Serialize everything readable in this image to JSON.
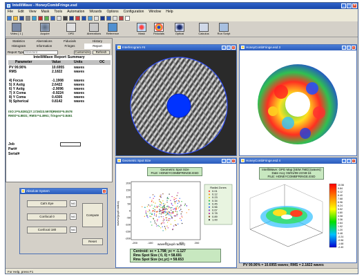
{
  "colors": {
    "title_blue": "#2a5bbb",
    "green_panel": "#c8e8c0",
    "pupil_blue": "#0033ff"
  },
  "window": {
    "title": "IntelliWave - HoneyCombFringe.esd"
  },
  "menu": [
    "File",
    "Edit",
    "View",
    "Mask",
    "Tools",
    "Automation",
    "Wizards",
    "Options",
    "Configuration",
    "Window",
    "Help"
  ],
  "toolbar": [
    "Video [ 1 ]",
    "Acquire",
    "OPD",
    "Aberrations",
    "Reference",
    "Mask",
    "Fiducials",
    "Optical",
    "Calculus",
    "Run Script"
  ],
  "report": {
    "tabs": [
      "Statistics",
      "Histogram",
      "Aberrations",
      "Information",
      "Fiducials",
      "Fringes",
      "History",
      "Report"
    ],
    "type_label": "Report Type",
    "type_value": "Standard",
    "customize": "Customize",
    "refresh": "Refresh",
    "title": "IntelliWave Report Summary",
    "headers": [
      "Parameter",
      "Value",
      "Units",
      "OC"
    ],
    "rows": [
      {
        "p": "PV 99.90%",
        "v": "10.6955",
        "u": "waves"
      },
      {
        "p": "RMS",
        "v": "2.1822",
        "u": "waves"
      },
      {
        "p": "4) Focus",
        "v": "-1.1908",
        "u": "waves"
      },
      {
        "p": "5) X Astig",
        "v": "2.6422",
        "u": "waves"
      },
      {
        "p": "6) Y Astig",
        "v": "-2.9096",
        "u": "waves"
      },
      {
        "p": "7) X Coma",
        "v": "-0.9224",
        "u": "waves"
      },
      {
        "p": "8) Y Coma",
        "v": "0.4305",
        "u": "waves"
      },
      {
        "p": "9) Spherical",
        "v": "0.8142",
        "u": "waves"
      }
    ],
    "summary1": "ISO:3=5.8281(27.1726/23.5978)RMSt=5.0578",
    "summary2": "RMSi=4.8831; RMSr=4.4951; fringes=2.8461",
    "inputs": [
      "Job",
      "Part#",
      "Serial#"
    ]
  },
  "absolute": {
    "title": "Absolute System",
    "buttons": [
      "Cat's Eye",
      "Confocal 0",
      "Confocal 180"
    ],
    "status": "NG",
    "compute": "Compute",
    "reset": "Reset"
  },
  "interferogram": {
    "title": "Interferogram #4"
  },
  "opdmap": {
    "title": "HoneyCombFringe.esd 3"
  },
  "spot": {
    "title": "Geometric Spot Size",
    "header1": "Geometric Spot Size",
    "header2": "FILE: HONEYCOMBFRINGE.ESD",
    "ylabel": "waves/(pupil radius)",
    "xlabel": "waves/(pupil radius)",
    "yticks": [
      "200",
      "150",
      "100",
      "50",
      "0",
      "-50",
      "-100",
      "-150",
      "-200"
    ],
    "xticks": [
      "-200",
      "-100",
      "0",
      "100",
      "200"
    ],
    "legend_title": "Radial Zones",
    "zones": [
      "0.01",
      "0.12",
      "0.23",
      "0.34",
      "0.45",
      "0.56",
      "0.67",
      "0.78",
      "0.89",
      "1.00"
    ],
    "centroid": "Centroid: xc = 1.798; yc = -1.127",
    "rms": "Rms Spot Size ( 0, 0) = 58.691",
    "rms2": "Rms Spot Size (xc,yc) = 58.653"
  },
  "map3d": {
    "title": "HoneyCombFringe.esd 4",
    "header1": "IntelliWave: OPD Map [SEM.TMD] (waves)",
    "header2": "Date Acq: 03/01/08 23:59:16",
    "header3": "FILE: HONEYCOMBFRINGE.ESD",
    "colorbar": [
      "10.56",
      "9.84",
      "9.12",
      "8.40",
      "7.68",
      "6.96",
      "6.24",
      "5.52",
      "4.80",
      "4.08",
      "3.36",
      "2.64",
      "1.92",
      "1.20",
      "0.48",
      "-0.24",
      "-0.96",
      "-1.68",
      "-2.40"
    ]
  },
  "pv_readout": "PV 99.90% = 10.6955 waves; RMS = 2.1822 waves",
  "status": "For Help, press F1"
}
